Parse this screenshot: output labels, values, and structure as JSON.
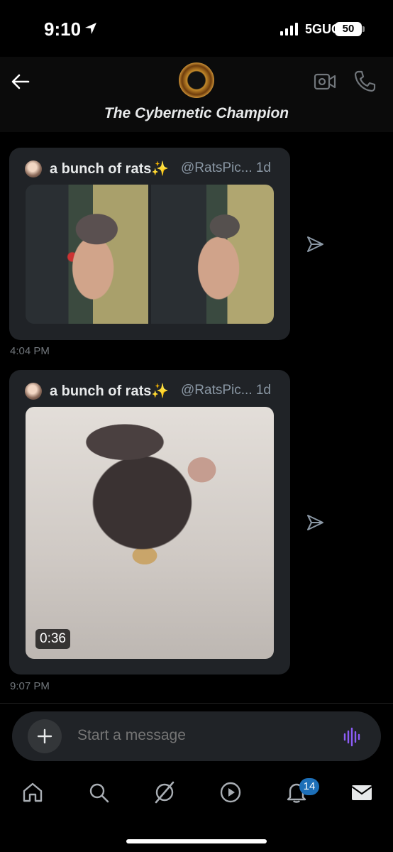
{
  "status_bar": {
    "time": "9:10",
    "network": "5GUC",
    "battery": "50"
  },
  "header": {
    "title": "The Cybernetic Champion"
  },
  "messages": [
    {
      "author": "a bunch of rats",
      "emoji": "✨",
      "handle": "@RatsPic... 1d",
      "timestamp": "4:04 PM",
      "media": "two photos"
    },
    {
      "author": "a bunch of rats",
      "emoji": "✨",
      "handle": "@RatsPic... 1d",
      "timestamp": "9:07 PM",
      "media": "video",
      "duration": "0:36"
    }
  ],
  "composer": {
    "placeholder": "Start a message"
  },
  "tabbar": {
    "items": [
      "home-icon",
      "search-icon",
      "grok-icon",
      "video-play-icon",
      "notifications-icon",
      "messages-icon"
    ],
    "notification_count": "14"
  },
  "colors": {
    "accent": "#1d6fb8",
    "voice": "#8b5cf6",
    "card_bg": "#202327"
  }
}
